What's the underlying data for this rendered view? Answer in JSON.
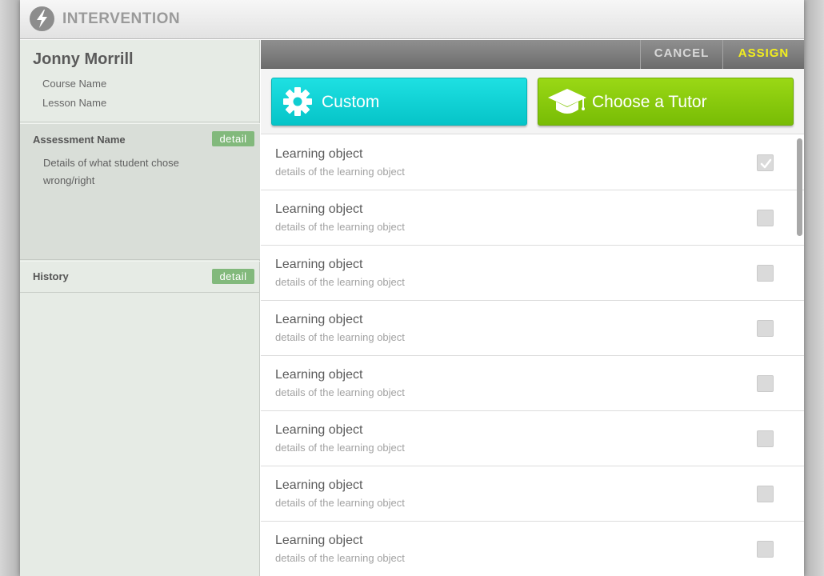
{
  "app": {
    "title": "INTERVENTION",
    "logo_icon": "lightning-bolt-icon"
  },
  "sidebar": {
    "student_name": "Jonny Morrill",
    "course_name": "Course Name",
    "lesson_name": "Lesson Name",
    "assessment": {
      "title": "Assessment Name",
      "detail_label": "detail",
      "details": "Details of what student chose wrong/right"
    },
    "history": {
      "title": "History",
      "detail_label": "detail"
    }
  },
  "actions": {
    "cancel_label": "CANCEL",
    "assign_label": "ASSIGN"
  },
  "type_buttons": {
    "custom": {
      "label": "Custom",
      "icon": "gear-icon",
      "color": "#0ccfd3"
    },
    "tutor": {
      "label": "Choose a Tutor",
      "icon": "graduation-cap-icon",
      "color": "#86c90b"
    }
  },
  "learning_objects": [
    {
      "title": "Learning object",
      "details": "details of the learning object",
      "checked": true
    },
    {
      "title": "Learning object",
      "details": "details of the learning object",
      "checked": false
    },
    {
      "title": "Learning object",
      "details": "details of the learning object",
      "checked": false
    },
    {
      "title": "Learning object",
      "details": "details of the learning object",
      "checked": false
    },
    {
      "title": "Learning object",
      "details": "details of the learning object",
      "checked": false
    },
    {
      "title": "Learning object",
      "details": "details of the learning object",
      "checked": false
    },
    {
      "title": "Learning object",
      "details": "details of the learning object",
      "checked": false
    },
    {
      "title": "Learning object",
      "details": "details of the learning object",
      "checked": false
    }
  ]
}
